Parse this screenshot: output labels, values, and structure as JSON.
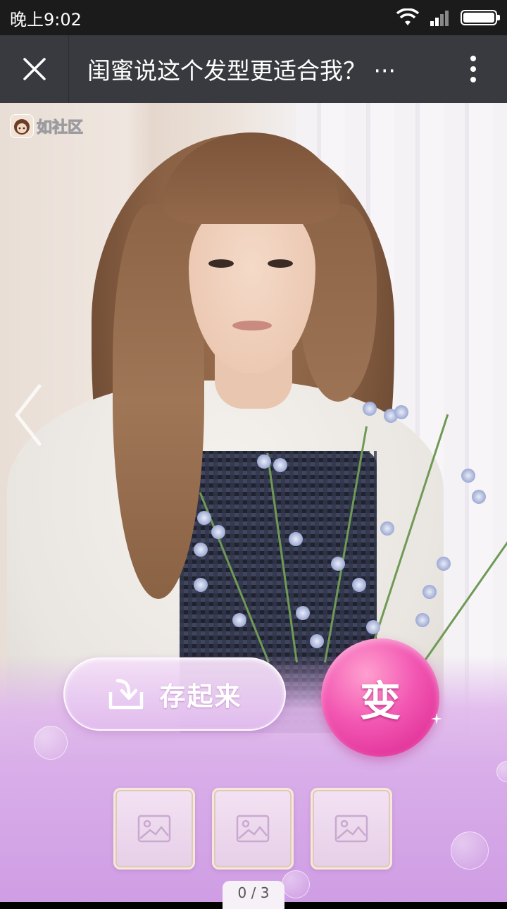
{
  "status_bar": {
    "time": "晚上9:02",
    "icons": [
      "wifi-icon",
      "signal-icon",
      "battery-icon"
    ]
  },
  "nav": {
    "title": "闺蜜说这个发型更适合我？",
    "close_icon": "close-icon",
    "more_icon": "more-vertical-icon"
  },
  "content": {
    "logo_text": "如社区",
    "arrow_icon": "chevron-left-icon"
  },
  "actions": {
    "save_label": "存起来",
    "change_label": "变"
  },
  "thumbnails": [
    {
      "icon": "image-placeholder-icon"
    },
    {
      "icon": "image-placeholder-icon"
    },
    {
      "icon": "image-placeholder-icon"
    }
  ],
  "pager": {
    "text": "0 / 3"
  },
  "colors": {
    "nav_bg": "#393a3f",
    "status_bg": "#1b1b1b",
    "accent_pink": "#f257b2",
    "panel_purple": "#d9aee9"
  }
}
